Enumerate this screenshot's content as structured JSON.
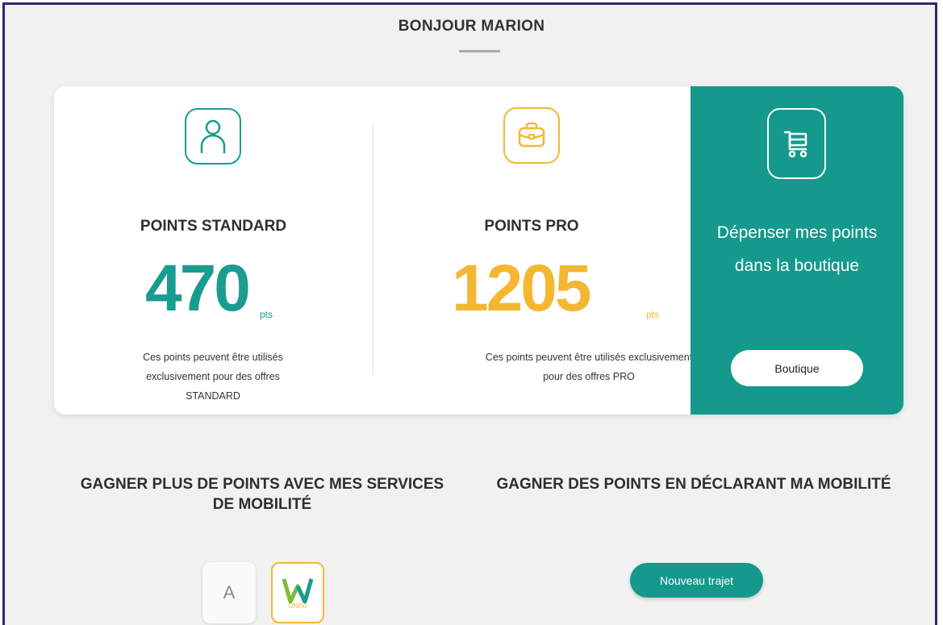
{
  "header": {
    "greeting": "BONJOUR MARION"
  },
  "points": {
    "standard": {
      "title": "POINTS STANDARD",
      "value": "470",
      "unit": "pts",
      "description": "Ces points peuvent être utilisés exclusivement pour des offres STANDARD",
      "icon": "user-icon"
    },
    "pro": {
      "title": "POINTS PRO",
      "value": "1205",
      "unit": "pts",
      "description": "Ces points peuvent être utilisés exclusivement pour des offres PRO",
      "icon": "briefcase-icon"
    },
    "shop": {
      "text": "Dépenser mes points dans la boutique",
      "button_label": "Boutique",
      "icon": "cart-icon"
    }
  },
  "sections": {
    "mobility_services": {
      "title": "GAGNER PLUS DE POINTS AVEC MES SERVICES DE MOBILITÉ",
      "apps": [
        {
          "label": "A"
        },
        {
          "label": "W",
          "sublabel": "UNFlo"
        }
      ]
    },
    "declare": {
      "title": "GAGNER DES POINTS EN DÉCLARANT MA MOBILITÉ",
      "button_label": "Nouveau trajet"
    }
  },
  "colors": {
    "teal": "#14998c",
    "gold": "#f4b731",
    "frame": "#2b2a6b"
  }
}
